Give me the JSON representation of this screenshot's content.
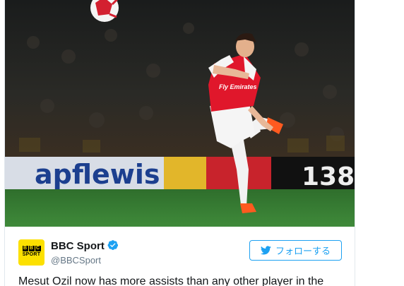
{
  "photo": {
    "board_text": "apflewis",
    "board_digits": "138",
    "shirt_text": "Fly Emirates"
  },
  "avatar": {
    "blocks": [
      "B",
      "B",
      "C"
    ],
    "word": "SPORT",
    "bg": "#fce000"
  },
  "author": {
    "name": "BBC Sport",
    "handle": "@BBCSport"
  },
  "follow_button": {
    "label": "フォローする"
  },
  "tweet": {
    "text": "Mesut Ozil now has more assists than any other player in the"
  },
  "colors": {
    "accent": "#1da1f2",
    "text": "#14171a",
    "muted": "#657786"
  }
}
